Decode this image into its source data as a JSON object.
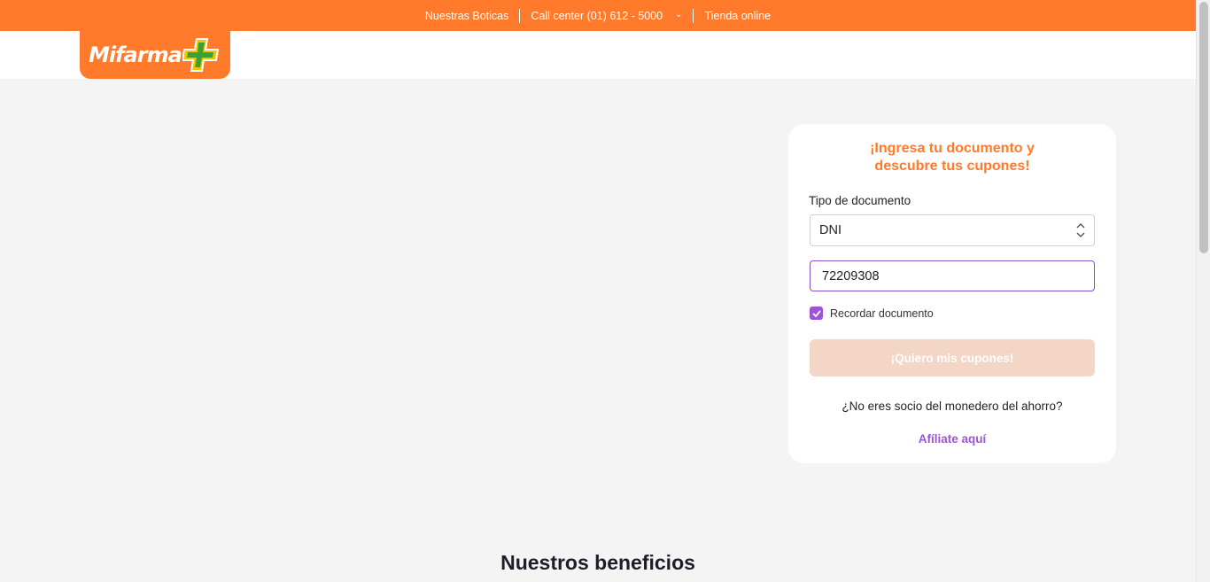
{
  "topbar": {
    "store_link": "Nuestras Boticas",
    "call_center": "Call center (01) 612 - 5000",
    "online_store": "Tienda online"
  },
  "brand": {
    "logo_text": "Mifarma",
    "accent_color": "#ff7a2b",
    "purple_color": "#9b55d6"
  },
  "form": {
    "title_line1": "¡Ingresa tu documento y",
    "title_line2": "descubre tus cupones!",
    "doc_type_label": "Tipo de documento",
    "doc_type_value": "DNI",
    "doc_number_value": "72209308",
    "remember_label": "Recordar documento",
    "remember_checked": true,
    "submit_label": "¡Quiero mis cupones!",
    "not_member_text": "¿No eres socio del monedero del ahorro?",
    "affiliate_link": "Afíliate aquí"
  },
  "benefits": {
    "title": "Nuestros beneficios"
  }
}
